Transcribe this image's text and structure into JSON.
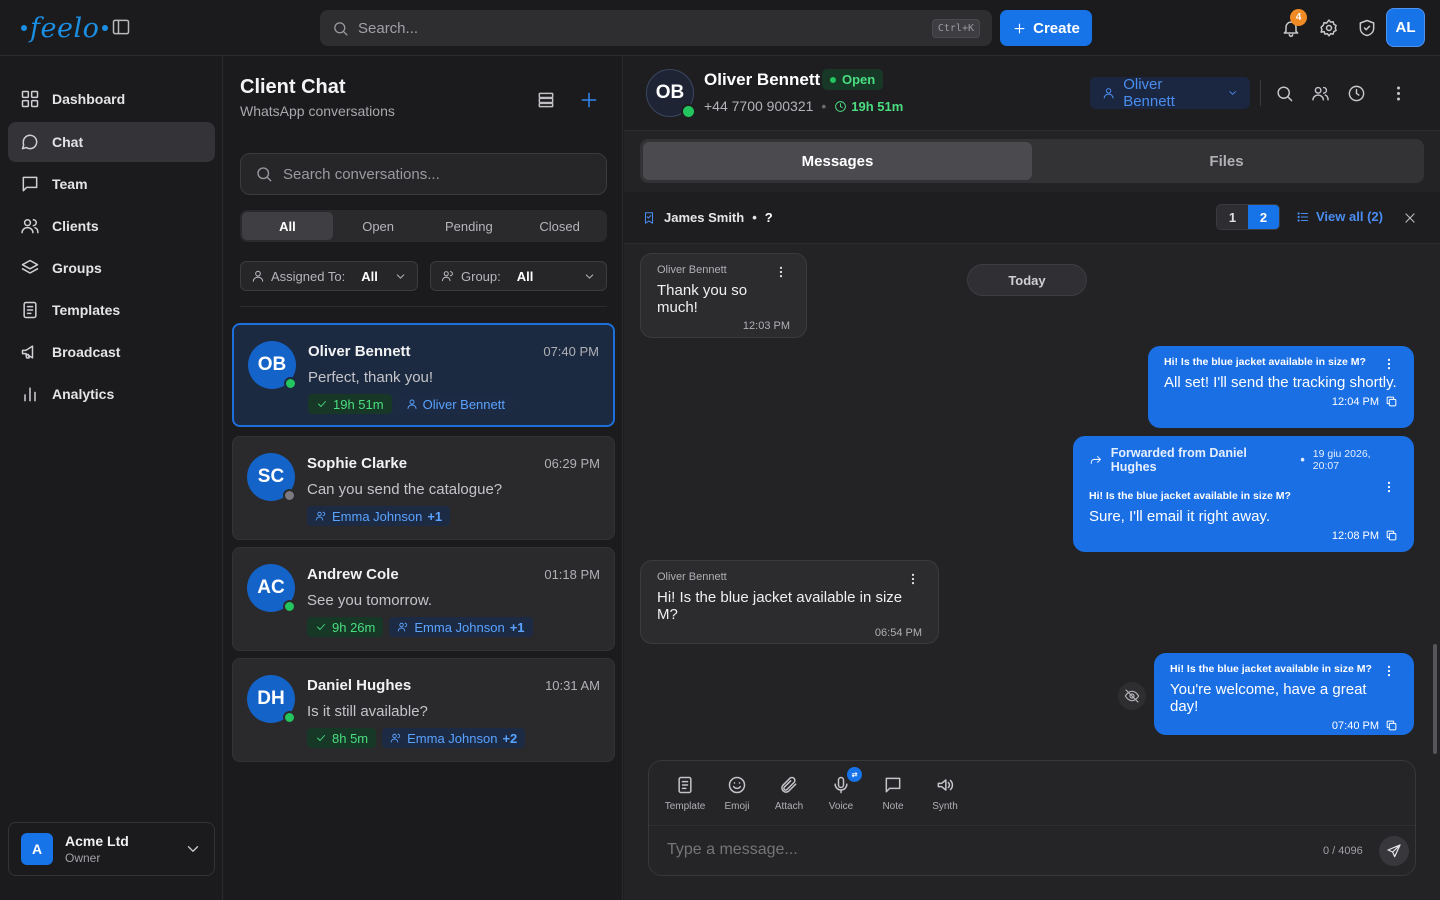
{
  "app": {
    "brand": "feelo",
    "accent": "#1773e8"
  },
  "topbar": {
    "search_placeholder": "Search...",
    "search_shortcut": "Ctrl+K",
    "create_label": "Create",
    "notification_count": "4",
    "user_initials": "AL"
  },
  "nav": {
    "items": [
      {
        "label": "Dashboard",
        "icon": "grid-icon"
      },
      {
        "label": "Chat",
        "icon": "chat-icon",
        "active": true
      },
      {
        "label": "Team",
        "icon": "message-square-icon"
      },
      {
        "label": "Clients",
        "icon": "users-icon"
      },
      {
        "label": "Groups",
        "icon": "layers-icon"
      },
      {
        "label": "Templates",
        "icon": "file-text-icon"
      },
      {
        "label": "Broadcast",
        "icon": "megaphone-icon"
      },
      {
        "label": "Analytics",
        "icon": "bar-chart-icon"
      }
    ],
    "org": {
      "badge": "A",
      "name": "Acme Ltd",
      "role": "Owner"
    }
  },
  "conv_list": {
    "title": "Client Chat",
    "subtitle": "WhatsApp conversations",
    "search_placeholder": "Search conversations...",
    "filters": [
      "All",
      "Open",
      "Pending",
      "Closed"
    ],
    "assigned_label": "Assigned To:",
    "assigned_value": "All",
    "group_label": "Group:",
    "group_value": "All",
    "conversations": [
      {
        "initials": "OB",
        "name": "Oliver Bennett",
        "time": "07:40 PM",
        "message": "Perfect, thank you!",
        "timer": "19h 51m",
        "assignee": "Oliver Bennett",
        "extra": "",
        "online": true
      },
      {
        "initials": "SC",
        "name": "Sophie Clarke",
        "time": "06:29 PM",
        "message": "Can you send the catalogue?",
        "timer": "",
        "assignee": "Emma Johnson",
        "extra": "+1",
        "online": false
      },
      {
        "initials": "AC",
        "name": "Andrew Cole",
        "time": "01:18 PM",
        "message": "See you tomorrow.",
        "timer": "9h 26m",
        "assignee": "Emma Johnson",
        "extra": "+1",
        "online": true
      },
      {
        "initials": "DH",
        "name": "Daniel Hughes",
        "time": "10:31 AM",
        "message": "Is it still available?",
        "timer": "8h 5m",
        "assignee": "Emma Johnson",
        "extra": "+2",
        "online": true
      }
    ]
  },
  "chat": {
    "contact_initials": "OB",
    "contact_name": "Oliver Bennett",
    "status": "Open",
    "phone": "+44 7700 900321",
    "timer": "19h 51m",
    "assignee": "Oliver Bennett",
    "tabs": [
      "Messages",
      "Files"
    ],
    "pinned": {
      "name": "James Smith",
      "suffix": "?",
      "pages": [
        "1",
        "2"
      ],
      "view_all": "View all (2)"
    },
    "today_label": "Today",
    "messages": {
      "m1": {
        "sender": "Oliver Bennett",
        "text": "Thank you so much!",
        "time": "12:03 PM"
      },
      "m2": {
        "quote": "Hi! Is the blue jacket available in size M?",
        "text": "All set! I'll send the tracking shortly.",
        "time": "12:04 PM"
      },
      "m3": {
        "forwarded": "Forwarded from Daniel Hughes",
        "forward_date": "19 giu 2026, 20:07",
        "quote": "Hi! Is the blue jacket available in size M?",
        "text": "Sure, I'll email it right away.",
        "time": "12:08 PM"
      },
      "m4": {
        "sender": "Oliver Bennett",
        "text": "Hi! Is the blue jacket available in size M?",
        "time": "06:54 PM"
      },
      "m5": {
        "quote": "Hi! Is the blue jacket available in size M?",
        "text": "You're welcome, have a great day!",
        "time": "07:40 PM"
      }
    },
    "tools": [
      "Template",
      "Emoji",
      "Attach",
      "Voice",
      "Note",
      "Synth"
    ],
    "composer_placeholder": "Type a message...",
    "counter": "0 / 4096"
  }
}
